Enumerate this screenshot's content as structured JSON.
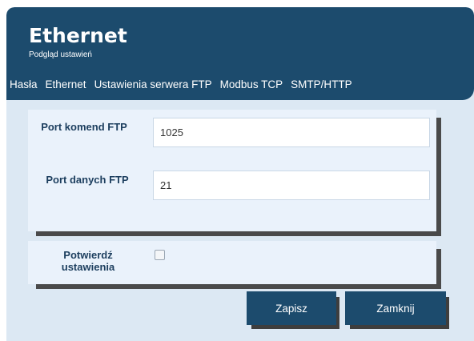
{
  "header": {
    "title": "Ethernet",
    "subtitle": "Podgląd ustawień"
  },
  "tabs": [
    {
      "label": "Hasła"
    },
    {
      "label": "Ethernet"
    },
    {
      "label": "Ustawienia serwera FTP"
    },
    {
      "label": "Modbus TCP"
    },
    {
      "label": "SMTP/HTTP"
    }
  ],
  "form": {
    "command_port_label": "Port komend FTP",
    "command_port_value": "1025",
    "data_port_label": "Port danych FTP",
    "data_port_value": "21"
  },
  "confirm": {
    "label_line1": "Potwierdź",
    "label_line2": "ustawienia",
    "checked": false
  },
  "buttons": {
    "save_label": "Zapisz",
    "close_label": "Zamknij"
  },
  "colors": {
    "header_bg": "#1c4b6d",
    "panel_bg": "#dce8f3",
    "card_bg": "#eaf2fb",
    "button_bg": "#1c4b6d"
  }
}
